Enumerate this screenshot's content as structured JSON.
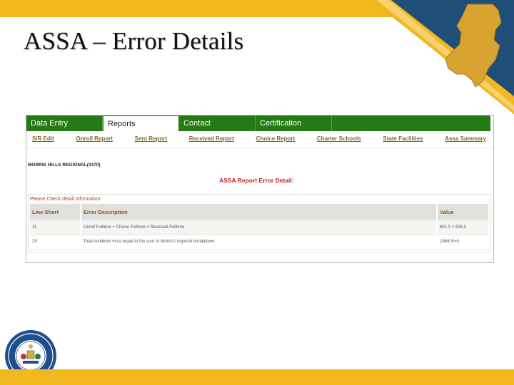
{
  "slide": {
    "title": "ASSA – Error Details"
  },
  "nav": {
    "tabs": [
      {
        "label": "Data Entry",
        "active": false
      },
      {
        "label": "Reports",
        "active": true
      },
      {
        "label": "Contact",
        "active": false
      },
      {
        "label": "Certification",
        "active": false
      }
    ]
  },
  "subnav": {
    "links": [
      "S/R Edit",
      "Onroll Report",
      "Sent Report",
      "Received Report",
      "Choice Report",
      "Charter Schools",
      "State Facilities",
      "Assa Summary"
    ]
  },
  "district": "MORRIS HILLS REGIONAL(3370)",
  "detail_title": "ASSA Report Error Detail:",
  "check_label": "Please Check detail information:",
  "table": {
    "headers": [
      "Line Short",
      "Error Description",
      "Value"
    ],
    "rows": [
      [
        "11",
        "Onroll Fulltime + Choice Fulltime < Received Fulltime",
        "601.0 < 606.0"
      ],
      [
        "29",
        "Total residents must equal to the sum of district's regional breakdown.",
        "1964.5!=0"
      ]
    ]
  },
  "colors": {
    "banner": "#f2b820",
    "nav_green": "#267a15",
    "corner_blue": "#1f4e79",
    "error_red": "#c62020"
  },
  "icons": {
    "state_map": "new-jersey-map-icon",
    "seal": "nj-department-of-education-seal"
  }
}
